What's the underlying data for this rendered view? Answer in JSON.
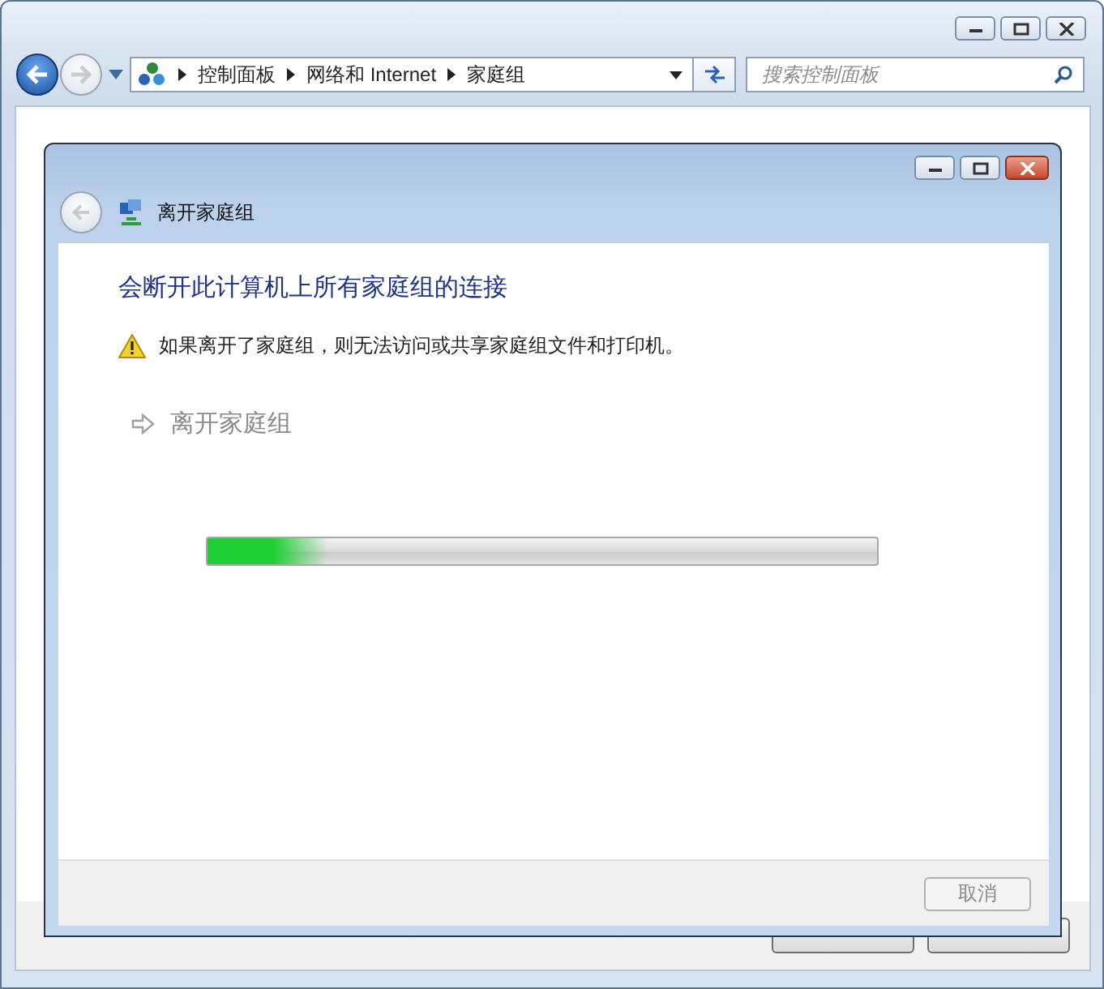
{
  "explorer": {
    "nav": [
      {
        "kind": "back",
        "disabled": false
      },
      {
        "kind": "forward",
        "disabled": true
      }
    ],
    "breadcrumbs": [
      "控制面板",
      "网络和 Internet",
      "家庭组"
    ],
    "search": {
      "placeholder": "搜索控制面板"
    },
    "buttons": [
      {
        "kind": "button"
      },
      {
        "kind": "button"
      }
    ]
  },
  "dialog": {
    "title": "离开家庭组",
    "back_disabled": true,
    "heading": "会断开此计算机上所有家庭组的连接",
    "warning": "如果离开了家庭组，则无法访问或共享家庭组文件和打印机。",
    "action": {
      "label": "离开家庭组",
      "disabled": true
    },
    "progress": {
      "level": 0.18
    },
    "buttons": [
      {
        "label": "取消",
        "disabled": true
      }
    ]
  }
}
